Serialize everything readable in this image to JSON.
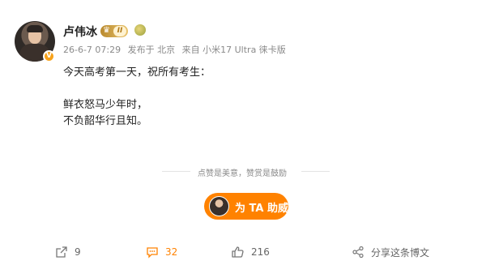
{
  "author": {
    "name": "卢伟冰",
    "verified_badge": "V",
    "level_badge": "II"
  },
  "meta": {
    "date": "26-6-7 07:29",
    "location": "发布于 北京",
    "source": "来自 小米17 Ultra 徕卡版"
  },
  "post": {
    "line1": "今天高考第一天，祝所有考生：",
    "line2": "鲜衣怒马少年时，",
    "line3": "不负韶华行且知。"
  },
  "reward": {
    "slogan": "点赞是美意，赞赏是鼓励",
    "button_label": "为 TA 助威"
  },
  "actions": {
    "repost_count": "9",
    "comment_count": "32",
    "like_count": "216",
    "share_label": "分享这条博文"
  },
  "colors": {
    "accent": "#ff8200",
    "muted": "#8a8a8a"
  },
  "icons": [
    "repost-icon",
    "comment-icon",
    "like-icon",
    "share-icon",
    "crown-icon",
    "medal-icon"
  ]
}
